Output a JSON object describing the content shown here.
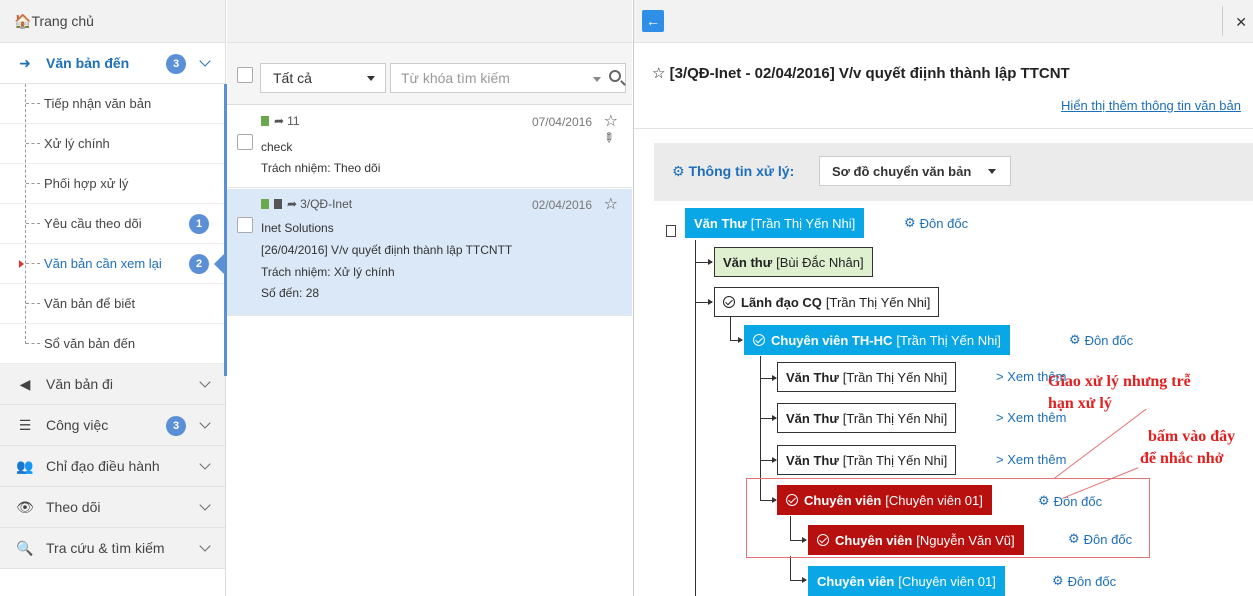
{
  "sidebar": {
    "home": "Trang chủ",
    "groups": [
      {
        "label": "Văn bản đến",
        "badge": "3"
      },
      {
        "label": "Văn bản đi"
      },
      {
        "label": "Công việc",
        "badge": "3"
      },
      {
        "label": "Chỉ đạo điều hành"
      },
      {
        "label": "Theo dõi"
      },
      {
        "label": "Tra cứu & tìm kiếm"
      }
    ],
    "sub_items": [
      {
        "label": "Tiếp nhận văn bản"
      },
      {
        "label": "Xử lý chính"
      },
      {
        "label": "Phối hợp xử lý"
      },
      {
        "label": "Yêu cầu theo dõi",
        "badge": "1"
      },
      {
        "label": "Văn bản cần xem lại",
        "badge": "2"
      },
      {
        "label": "Văn bản để biết"
      },
      {
        "label": "Sổ văn bản đến"
      }
    ]
  },
  "filter": {
    "select_value": "Tất cả",
    "search_placeholder": "Từ khóa tìm kiếm"
  },
  "list": [
    {
      "num": "11",
      "date": "07/04/2016",
      "line1": "check",
      "line2": "Trách nhiệm: Theo dõi"
    },
    {
      "num": "3/QĐ-Inet",
      "date": "02/04/2016",
      "line1": "Inet Solutions",
      "line2": "[26/04/2016] V/v quyết điịnh thành lập TTCNTT",
      "line3": "Trách nhiệm: Xử lý chính",
      "line4": "Số đến: 28"
    }
  ],
  "detail": {
    "title": "[3/QĐ-Inet - 02/04/2016] V/v quyết điịnh thành lập TTCNT",
    "show_more": "Hiển thị thêm thông tin văn bản",
    "info_label": "Thông tin xử lý:",
    "info_select": "Sơ đồ chuyển văn bản",
    "don_doc": "Đôn đốc",
    "xem_them": "> Xem thêm"
  },
  "tree": [
    {
      "role": "Văn Thư",
      "person": "[Trần Thị Yến Nhi]"
    },
    {
      "role": "Văn thư",
      "person": "[Bùi Đắc Nhân]"
    },
    {
      "role": "Lãnh đạo CQ",
      "person": "[Trần Thị Yến Nhi]"
    },
    {
      "role": "Chuyên viên TH-HC",
      "person": "[Trần Thị Yến Nhi]"
    },
    {
      "role": "Văn Thư",
      "person": "[Trần Thị Yến Nhi]"
    },
    {
      "role": "Văn Thư",
      "person": "[Trần Thị Yến Nhi]"
    },
    {
      "role": "Văn Thư",
      "person": "[Trần Thị Yến Nhi]"
    },
    {
      "role": "Chuyên viên",
      "person": "[Chuyên viên 01]"
    },
    {
      "role": "Chuyên viên",
      "person": "[Nguyễn Văn Vũ]"
    },
    {
      "role": "Chuyên viên",
      "person": "[Chuyên viên 01]"
    }
  ],
  "annotations": {
    "late_line1": "Giao xử lý nhưng trễ",
    "late_line2": "hạn xử lý",
    "click_line1": "bấm vào đây",
    "click_line2": "để nhắc nhở"
  },
  "colors": {
    "accent": "#1e6fba",
    "badge": "#5b8fd6",
    "node_cyan": "#0aa7e6",
    "node_red": "#b80f0f",
    "node_green": "#dff0d0",
    "annotation": "#e02020"
  }
}
